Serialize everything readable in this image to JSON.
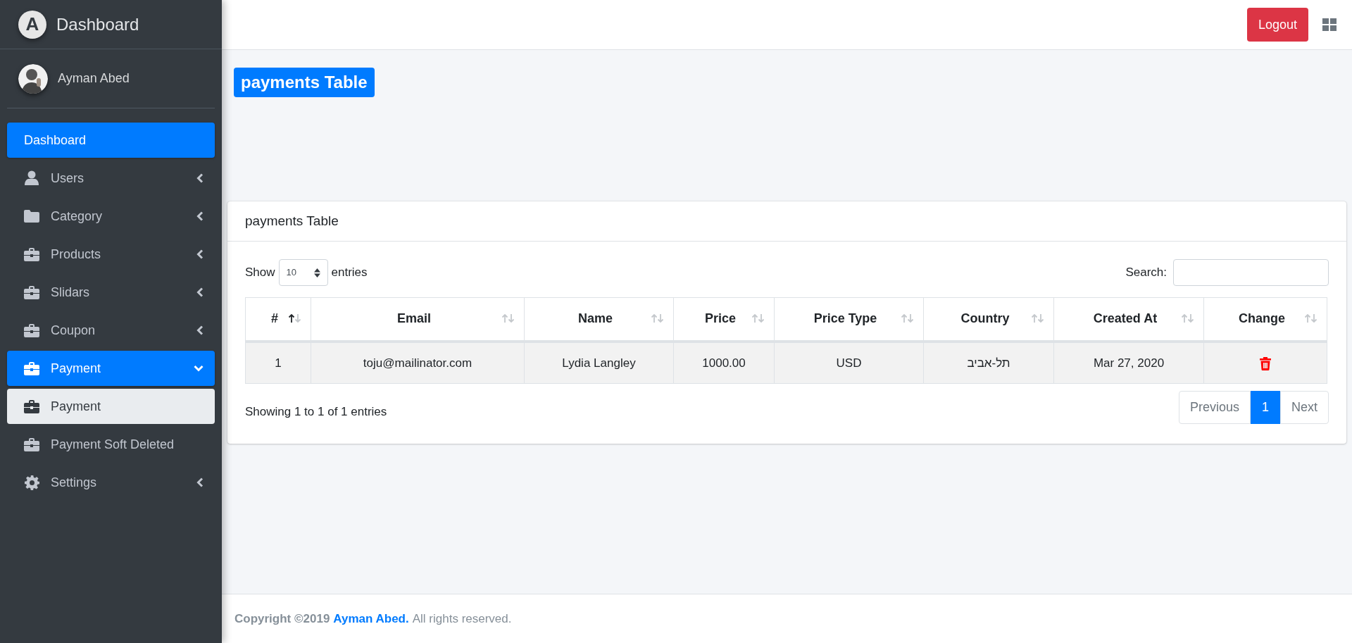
{
  "brand": {
    "logo_letter": "A",
    "title": "Dashboard"
  },
  "user": {
    "name": "Ayman Abed"
  },
  "sidebar": {
    "items": [
      {
        "label": "Dashboard",
        "kind": "plain",
        "selected": true
      },
      {
        "label": "Users",
        "kind": "person",
        "selected": false,
        "expanded": false
      },
      {
        "label": "Category",
        "kind": "folder",
        "selected": false,
        "expanded": false
      },
      {
        "label": "Products",
        "kind": "case",
        "selected": false,
        "expanded": false
      },
      {
        "label": "Slidars",
        "kind": "case",
        "selected": false,
        "expanded": false
      },
      {
        "label": "Coupon",
        "kind": "case",
        "selected": false,
        "expanded": false
      },
      {
        "label": "Payment",
        "kind": "case",
        "selected": true,
        "expanded": true,
        "children": [
          {
            "label": "Payment",
            "kind": "case",
            "selected": true
          },
          {
            "label": "Payment Soft Deleted",
            "kind": "case",
            "selected": false
          }
        ]
      },
      {
        "label": "Settings",
        "kind": "gear",
        "selected": false,
        "expanded": false
      }
    ]
  },
  "header": {
    "logout": "Logout"
  },
  "page_badge": "payments Table",
  "card": {
    "title": "payments Table",
    "length": {
      "show": "Show",
      "value": "10",
      "entries": "entries"
    },
    "search": {
      "label": "Search:"
    },
    "table": {
      "columns": [
        {
          "label": "#",
          "sorted": true
        },
        {
          "label": "Email",
          "sorted": false
        },
        {
          "label": "Name",
          "sorted": false
        },
        {
          "label": "Price",
          "sorted": false
        },
        {
          "label": "Price Type",
          "sorted": false
        },
        {
          "label": "Country",
          "sorted": false
        },
        {
          "label": "Created At",
          "sorted": false
        },
        {
          "label": "Change",
          "sorted": false
        }
      ],
      "rows": [
        {
          "cells": [
            "1",
            "toju@mailinator.com",
            "Lydia Langley",
            "1000.00",
            "USD",
            "תל-אביב",
            "Mar 27, 2020"
          ],
          "deletable": true
        }
      ]
    },
    "info": "Showing 1 to 1 of 1 entries",
    "pagination": [
      {
        "label": "Previous",
        "selected": false
      },
      {
        "label": "1",
        "selected": true
      },
      {
        "label": "Next",
        "selected": false
      }
    ]
  },
  "footer": {
    "prefix": "Copyright ©2019",
    "link": "Ayman Abed.",
    "suffix": "All rights reserved."
  }
}
